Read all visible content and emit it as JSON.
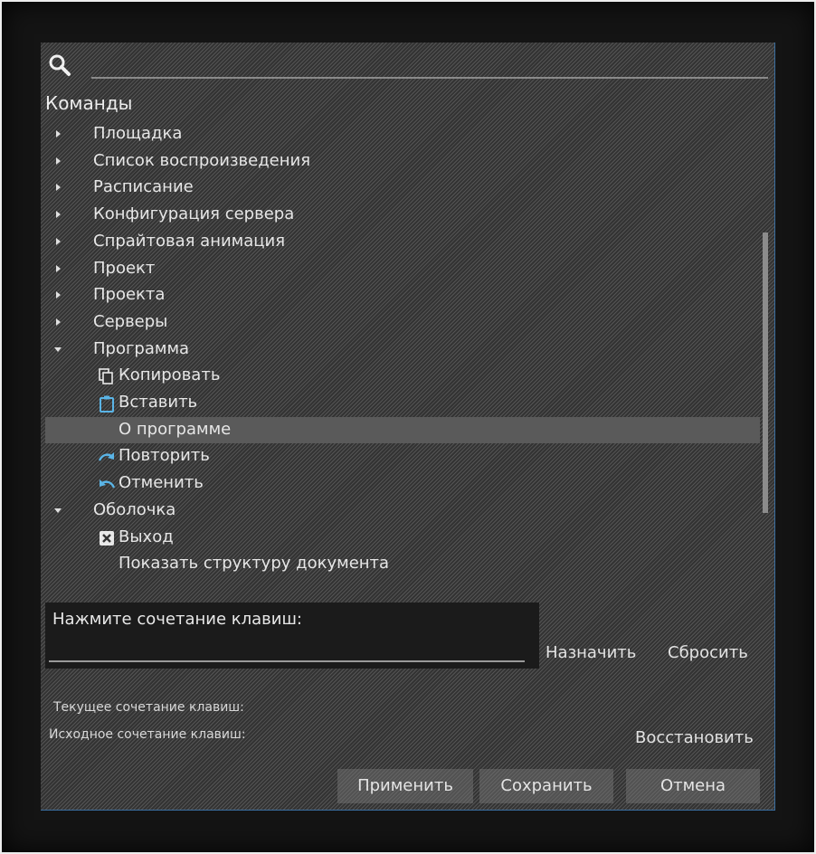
{
  "search": {
    "value": "",
    "placeholder": ""
  },
  "commands_title": "Команды",
  "tree": [
    {
      "label": "Площадка",
      "kind": "group",
      "expanded": false
    },
    {
      "label": "Список воспроизведения",
      "kind": "group",
      "expanded": false
    },
    {
      "label": "Расписание",
      "kind": "group",
      "expanded": false
    },
    {
      "label": "Конфигурация сервера",
      "kind": "group",
      "expanded": false
    },
    {
      "label": "Спрайтовая анимация",
      "kind": "group",
      "expanded": false
    },
    {
      "label": "Проект",
      "kind": "group",
      "expanded": false
    },
    {
      "label": "Проекта",
      "kind": "group",
      "expanded": false
    },
    {
      "label": "Серверы",
      "kind": "group",
      "expanded": false
    },
    {
      "label": "Программа",
      "kind": "group",
      "expanded": true
    },
    {
      "label": "Копировать",
      "kind": "leaf",
      "icon": "copy-icon"
    },
    {
      "label": "Вставить",
      "kind": "leaf",
      "icon": "paste-icon"
    },
    {
      "label": "О программе",
      "kind": "leaf",
      "icon": "",
      "selected": true
    },
    {
      "label": "Повторить",
      "kind": "leaf",
      "icon": "redo-icon"
    },
    {
      "label": "Отменить",
      "kind": "leaf",
      "icon": "undo-icon"
    },
    {
      "label": "Оболочка",
      "kind": "group",
      "expanded": true
    },
    {
      "label": "Выход",
      "kind": "leaf",
      "icon": "exit-icon"
    },
    {
      "label": "Показать структуру документа",
      "kind": "leaf",
      "icon": ""
    },
    {
      "label": "",
      "kind": "leaf",
      "icon": "document-icon"
    }
  ],
  "key_entry": {
    "label": "Нажмите сочетание клавиш:",
    "value": ""
  },
  "assign_label": "Назначить",
  "reset_label": "Сбросить",
  "current_shortcut_label": "Текущее сочетание клавиш:",
  "default_shortcut_label": "Исходное сочетание клавиш:",
  "restore_label": "Восстановить",
  "buttons": {
    "apply": "Применить",
    "save": "Сохранить",
    "cancel": "Отмена"
  },
  "colors": {
    "icon_blue": "#5ab4e6",
    "selection": "#5a5a5a"
  }
}
